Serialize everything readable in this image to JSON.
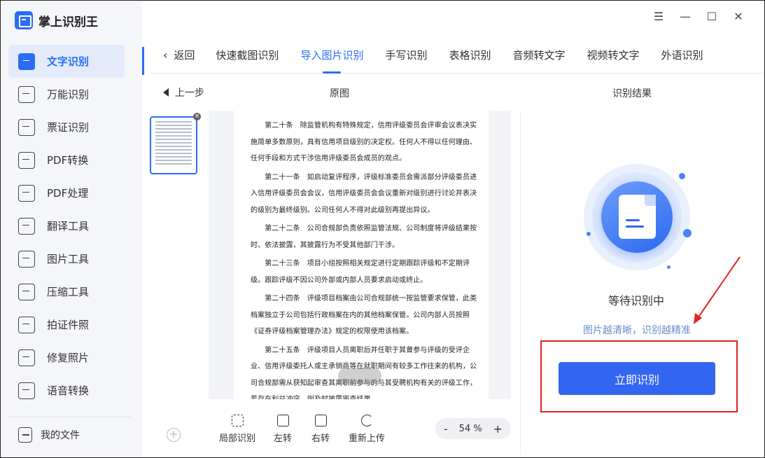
{
  "app": {
    "name": "掌上识别王"
  },
  "window": {
    "controls": [
      "☰",
      "—",
      "☐",
      "✕"
    ]
  },
  "sidebar": {
    "items": [
      {
        "label": "文字识别",
        "active": true,
        "icon": "text-recognition-icon"
      },
      {
        "label": "万能识别",
        "icon": "universal-scan-icon"
      },
      {
        "label": "票证识别",
        "icon": "ticket-icon"
      },
      {
        "label": "PDF转换",
        "icon": "pdf-convert-icon"
      },
      {
        "label": "PDF处理",
        "icon": "pdf-process-icon"
      },
      {
        "label": "翻译工具",
        "icon": "translate-icon"
      },
      {
        "label": "图片工具",
        "icon": "image-tool-icon"
      },
      {
        "label": "压缩工具",
        "icon": "compress-icon"
      },
      {
        "label": "拍证件照",
        "icon": "id-photo-icon"
      },
      {
        "label": "修复照片",
        "icon": "photo-repair-icon"
      },
      {
        "label": "语音转换",
        "icon": "voice-convert-icon"
      }
    ],
    "my_files": "我的文件"
  },
  "tabs": {
    "back_label": "返回",
    "items": [
      {
        "label": "快速截图识别"
      },
      {
        "label": "导入图片识别",
        "active": true
      },
      {
        "label": "手写识别"
      },
      {
        "label": "表格识别"
      },
      {
        "label": "音频转文字"
      },
      {
        "label": "视频转文字"
      },
      {
        "label": "外语识别"
      }
    ]
  },
  "subheader": {
    "prev_step": "上一步",
    "original": "原图",
    "result": "识别结果"
  },
  "document": {
    "paragraphs": [
      "　　第二十条　除监管机构有特殊规定，信用评级委员会评审会议表决实施简单多数原则，具有信用项目级别的决定权。任何人不得以任何理由、任何手段和方式干涉信用评级委员会成员的观点。",
      "　　第二十一条　如启动复评程序，评级标准委员会需派部分评级委员进入信用评级委员会会议，信用评级委员会会议重新对级别进行讨论并表决的级别为最终级别。公司任何人不得对此级别再提出异议。",
      "　　第二十二条　公司合规部负责依照监管法规、公司制度将评级结果按时、依法披露，其披露行为不受其他部门干涉。",
      "　　第二十三条　项目小组按照相关规定进行定期跟踪评级和不定期评级。跟踪评级不因公司外部或内部人员要求启动或终止。",
      "　　第二十四条　评级项目档案由公司合规部统一按监管要求保管，此类档案独立于公司包括行政档案在内的其他档案保管。公司内部人员按照《证券评级档案管理办法》规定的权限使用该档案。",
      "　　第二十五条　评级项目人员离职后并任职于其曾参与评级的受评企业、信用评级委托人或主承销商等在就职期间有较多工作往来的机构，公司合规部需从获知起审查其离职前参与的与其受聘机构有关的评级工作，若存在利益冲突，则及时披露审查结果。"
    ]
  },
  "toolbar": {
    "crop": "局部识别",
    "rotate_left": "左转",
    "rotate_right": "右转",
    "reupload": "重新上传",
    "zoom_minus": "-",
    "zoom_value": "54 %",
    "zoom_plus": "+"
  },
  "result": {
    "status": "等待识别中",
    "hint": "图片越清晰，识别越精准",
    "start_button": "立即识别"
  },
  "colors": {
    "accent": "#2a6df4",
    "highlight_box": "#e02323"
  }
}
